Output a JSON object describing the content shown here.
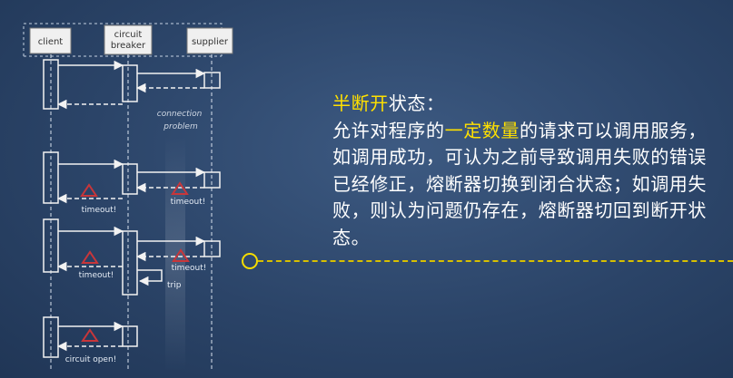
{
  "diagram": {
    "participants": [
      "client",
      "circuit breaker",
      "supplier"
    ],
    "participant_lines": [
      [
        "client"
      ],
      [
        "circuit",
        "breaker"
      ],
      [
        "supplier"
      ]
    ],
    "note": [
      "connection",
      "problem"
    ],
    "labels": {
      "timeout_1": "timeout!",
      "timeout_2": "timeout!",
      "timeout_3": "timeout!",
      "timeout_4": "timeout!",
      "trip": "trip",
      "circuit_open": "circuit open!"
    }
  },
  "panel": {
    "title": "半断开",
    "title_rest": "状态：",
    "line1_pre": "允许对程序的",
    "line1_hl": "一定数量",
    "line1_post": "的请求可以调用",
    "rest": "服务，如调用成功，可认为之前导致调用失败的错误已经修正，熔断器切换到闭合状态；如调用失败，则认为问题仍存在，熔断器切回到断开状态。"
  },
  "colors": {
    "highlight": "#ffe000",
    "timeline": "#f5dc00",
    "warning_triangle": "#c8363a",
    "header_box": "#f0f0f0"
  }
}
